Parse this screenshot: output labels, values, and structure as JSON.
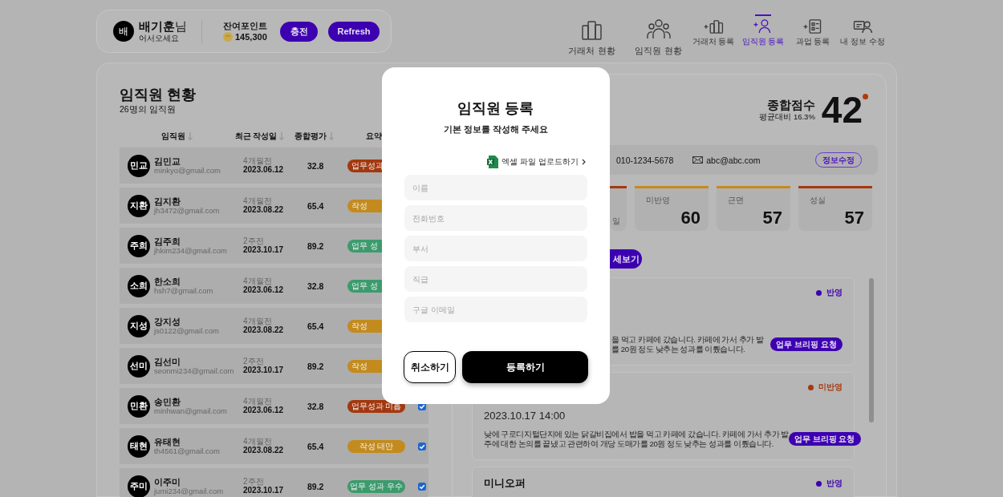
{
  "header": {
    "avatar": "배",
    "name": "**배기훈**님",
    "greeting": "어서오세요",
    "points_label": "잔여포인트",
    "points": "145,300",
    "buttons": [
      "충전",
      "Refresh"
    ]
  },
  "nav": [
    {
      "label": "거래처 현황",
      "kind": "main",
      "selected": false
    },
    {
      "label": "임직원 현황",
      "kind": "main",
      "selected": false
    },
    {
      "label": "거래처 등록",
      "kind": "sub",
      "selected": false
    },
    {
      "label": "임직원 등록",
      "kind": "sub",
      "selected": true
    },
    {
      "label": "과업 등록",
      "kind": "sub",
      "selected": false
    },
    {
      "label": "내 정보 수정",
      "kind": "sub",
      "selected": false
    }
  ],
  "employees": {
    "title": "임직원 현황",
    "count": "26명의 임직원",
    "columns": [
      {
        "label": "임직원",
        "sortable": true
      },
      {
        "label": "최근 작성일",
        "sortable": true
      },
      {
        "label": "종합평가",
        "sortable": true
      },
      {
        "label": "요약",
        "sortable": false
      }
    ],
    "rows": [
      {
        "initials": "민교",
        "name": "김민교",
        "email": "minkyo@gmail.com",
        "ago": "4개월전",
        "date": "2023.06.12",
        "score": "32.8",
        "badge": {
          "text": "업무성과",
          "color": "#a3380e",
          "cut": true
        }
      },
      {
        "initials": "지환",
        "name": "김지환",
        "email": "jh3472@gmail.com",
        "ago": "4개월전",
        "date": "2023.08.22",
        "score": "65.4",
        "badge": {
          "text": "작성",
          "color": "#c38b1d",
          "cut": true
        }
      },
      {
        "initials": "주희",
        "name": "김주희",
        "email": "jhkim234@gmail.com",
        "ago": "2주전",
        "date": "2023.10.17",
        "score": "89.2",
        "badge": {
          "text": "업무 성",
          "color": "#3c9b6d",
          "cut": true
        }
      },
      {
        "initials": "소희",
        "name": "한소희",
        "email": "hsh7@gmail.com",
        "ago": "4개월전",
        "date": "2023.06.12",
        "score": "32.8",
        "badge": {
          "text": "업무 성",
          "color": "#3c9b6d",
          "cut": true
        }
      },
      {
        "initials": "지성",
        "name": "강지성",
        "email": "js0122@gmail.com",
        "ago": "4개월전",
        "date": "2023.08.22",
        "score": "65.4",
        "badge": {
          "text": "작성",
          "color": "#c38b1d",
          "cut": true
        }
      },
      {
        "initials": "선미",
        "name": "김선미",
        "email": "seonmi234@gmail.com",
        "ago": "2주전",
        "date": "2023.10.17",
        "score": "89.2",
        "badge": {
          "text": "작성",
          "color": "#c38b1d",
          "cut": true
        }
      },
      {
        "initials": "민환",
        "name": "송민환",
        "email": "minhwan@gmail.com",
        "ago": "4개월전",
        "date": "2023.06.12",
        "score": "32.8",
        "badge": {
          "text": "업무성과 미흡",
          "color": "#a3380e",
          "cut": false
        },
        "checked": true
      },
      {
        "initials": "태현",
        "name": "유태현",
        "email": "th4561@gmail.com",
        "ago": "4개월전",
        "date": "2023.08.22",
        "score": "65.4",
        "badge": {
          "text": "작성 태만",
          "color": "#c38b1d",
          "cut": false
        },
        "checked": true
      },
      {
        "initials": "주미",
        "name": "이주미",
        "email": "jumi234@gmail.com",
        "ago": "2주전",
        "date": "2023.10.17",
        "score": "89.2",
        "badge": {
          "text": "업무 성과 우수",
          "color": "#3c9b6d",
          "cut": false
        },
        "checked": true
      }
    ]
  },
  "summary": {
    "score_label": "종합점수",
    "compare": "평균대비 16.3%",
    "score": "42",
    "alert": true,
    "phone": "010-1234-5678",
    "email": "abc@abc.com",
    "edit_button": "정보수정",
    "stats": [
      {
        "kind": "partial",
        "value": "일",
        "color": "#a8380e"
      },
      {
        "kind": "full",
        "label": "미반영",
        "value": "60",
        "color": "#c58a1c"
      },
      {
        "kind": "full",
        "label": "근면",
        "value": "57",
        "color": "#c58a1c"
      },
      {
        "kind": "full",
        "label": "성실",
        "value": "57",
        "color": "#a8380e"
      }
    ],
    "detail_button": "세보기",
    "reports": [
      {
        "kind": "partial",
        "status": "반영",
        "color": "#3d00b0",
        "text": "을 먹고 카페에 갔습니다. 카페에 가서 추가 발\n를 20원 정도 낮추는 성과를 이뤘습니다.",
        "action": "업무 브리핑 요청"
      },
      {
        "kind": "full",
        "status": "미반영",
        "color": "#a8380e",
        "date": "2023.10.17 14:00",
        "text": "낮에 구로디지털단지에 있는 닭갈비집에서 밥을 먹고 카페에 갔습니다. 카페에 가서 추가 발\n주에 대한 논의를 끝냈고 관련하여 개당 도매가를 20원 정도 낮추는 성과를 이뤘습니다.",
        "action": "업무 브리핑 요청"
      },
      {
        "kind": "full",
        "title": "미니오퍼",
        "status": "반영",
        "color": "#3d00b0"
      }
    ]
  },
  "modal": {
    "title": "임직원 등록",
    "subtitle": "기본 정보를 작성해 주세요",
    "upload_link": "엑셀 파일 업로드하기",
    "fields": [
      {
        "placeholder": "이름"
      },
      {
        "placeholder": "전화번호"
      },
      {
        "placeholder": "부서"
      },
      {
        "placeholder": "직급"
      },
      {
        "placeholder": "구글 이메일"
      }
    ],
    "buttons": [
      {
        "label": "취소하기",
        "kind": "secondary"
      },
      {
        "label": "등록하기",
        "kind": "primary"
      }
    ]
  }
}
